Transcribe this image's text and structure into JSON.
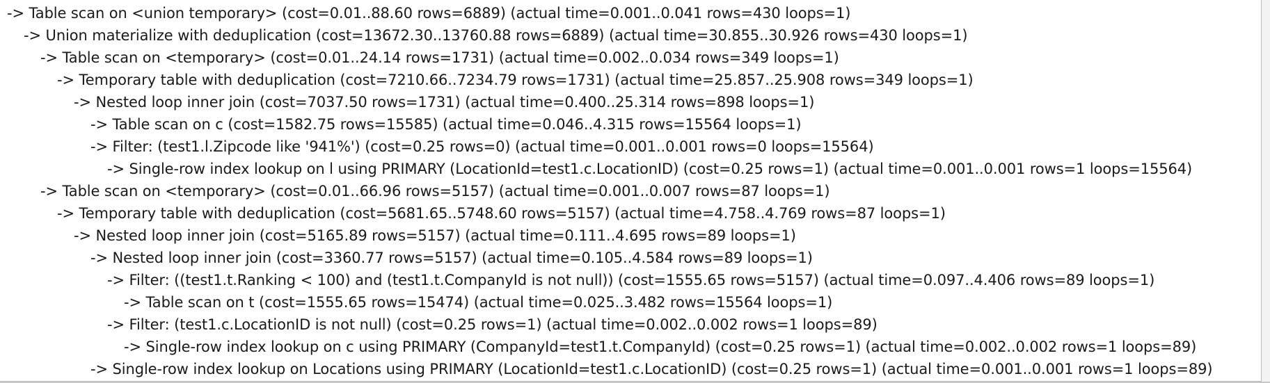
{
  "plan": {
    "lines": [
      {
        "indent": 0,
        "text": "-> Table scan on <union temporary>  (cost=0.01..88.60 rows=6889) (actual time=0.001..0.041 rows=430 loops=1)"
      },
      {
        "indent": 1,
        "text": "-> Union materialize with deduplication  (cost=13672.30..13760.88 rows=6889) (actual time=30.855..30.926 rows=430 loops=1)"
      },
      {
        "indent": 2,
        "text": "-> Table scan on <temporary>  (cost=0.01..24.14 rows=1731) (actual time=0.002..0.034 rows=349 loops=1)"
      },
      {
        "indent": 3,
        "text": "-> Temporary table with deduplication  (cost=7210.66..7234.79 rows=1731) (actual time=25.857..25.908 rows=349 loops=1)"
      },
      {
        "indent": 4,
        "text": "-> Nested loop inner join  (cost=7037.50 rows=1731) (actual time=0.400..25.314 rows=898 loops=1)"
      },
      {
        "indent": 5,
        "text": "-> Table scan on c  (cost=1582.75 rows=15585) (actual time=0.046..4.315 rows=15564 loops=1)"
      },
      {
        "indent": 5,
        "text": "-> Filter: (test1.l.Zipcode like '941%')  (cost=0.25 rows=0) (actual time=0.001..0.001 rows=0 loops=15564)"
      },
      {
        "indent": 6,
        "text": "-> Single-row index lookup on l using PRIMARY (LocationId=test1.c.LocationID)  (cost=0.25 rows=1) (actual time=0.001..0.001 rows=1 loops=15564)"
      },
      {
        "indent": 2,
        "text": "-> Table scan on <temporary>  (cost=0.01..66.96 rows=5157) (actual time=0.001..0.007 rows=87 loops=1)"
      },
      {
        "indent": 3,
        "text": "-> Temporary table with deduplication  (cost=5681.65..5748.60 rows=5157) (actual time=4.758..4.769 rows=87 loops=1)"
      },
      {
        "indent": 4,
        "text": "-> Nested loop inner join  (cost=5165.89 rows=5157) (actual time=0.111..4.695 rows=89 loops=1)"
      },
      {
        "indent": 5,
        "text": "-> Nested loop inner join  (cost=3360.77 rows=5157) (actual time=0.105..4.584 rows=89 loops=1)"
      },
      {
        "indent": 6,
        "text": "-> Filter: ((test1.t.Ranking < 100) and (test1.t.CompanyId is not null))  (cost=1555.65 rows=5157) (actual time=0.097..4.406 rows=89 loops=1)"
      },
      {
        "indent": 7,
        "text": "-> Table scan on t  (cost=1555.65 rows=15474) (actual time=0.025..3.482 rows=15564 loops=1)"
      },
      {
        "indent": 6,
        "text": "-> Filter: (test1.c.LocationID is not null)  (cost=0.25 rows=1) (actual time=0.002..0.002 rows=1 loops=89)"
      },
      {
        "indent": 7,
        "text": "-> Single-row index lookup on c using PRIMARY (CompanyId=test1.t.CompanyId)  (cost=0.25 rows=1) (actual time=0.002..0.002 rows=1 loops=89)"
      },
      {
        "indent": 5,
        "text": "-> Single-row index lookup on Locations using PRIMARY (LocationId=test1.c.LocationID)  (cost=0.25 rows=1) (actual time=0.001..0.001 rows=1 loops=89)"
      }
    ]
  }
}
